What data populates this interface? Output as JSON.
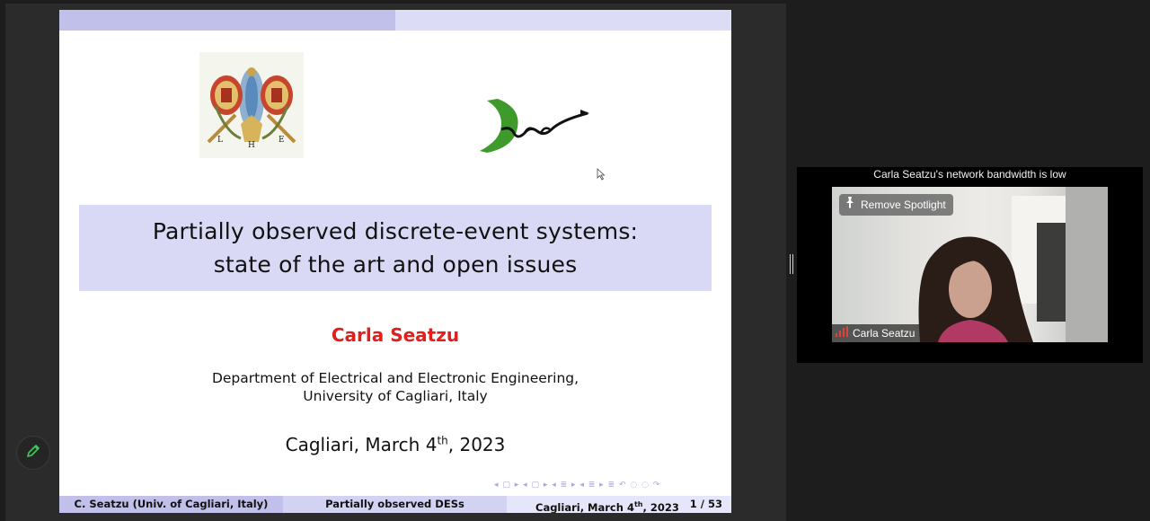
{
  "slide": {
    "title_line1": "Partially observed discrete-event systems:",
    "title_line2": "state of the art and open issues",
    "author": "Carla Seatzu",
    "affiliation_line1": "Department of Electrical and Electronic Engineering,",
    "affiliation_line2": "University of Cagliari, Italy",
    "date_prefix": "Cagliari, March 4",
    "date_sup": "th",
    "date_suffix": ", 2023",
    "footer": {
      "author": "C. Seatzu  (Univ. of Cagliari, Italy)",
      "short_title": "Partially observed DESs",
      "date_prefix": "Cagliari, March 4",
      "date_sup": "th",
      "date_suffix": ", 2023",
      "page": "1 / 53"
    },
    "nav_symbols": "◂ ▢ ▸   ◂ ▢ ▸   ◂ ≣ ▸   ◂ ≣ ▸   ≣   ↶ ◌ ◌ ↷"
  },
  "video": {
    "bandwidth_warning": "Carla Seatzu's network bandwidth is low",
    "remove_spotlight_label": "Remove Spotlight",
    "participant_name": "Carla Seatzu"
  },
  "icons": {
    "annotate": "pencil-icon",
    "pin": "pin-icon",
    "signal": "signal-bars-icon"
  },
  "colors": {
    "author": "#e0201c",
    "bar_dark": "#c0c0ea",
    "bar_light": "#dcdcf7",
    "signal": "#e0433a",
    "annotate": "#3ec95a"
  }
}
